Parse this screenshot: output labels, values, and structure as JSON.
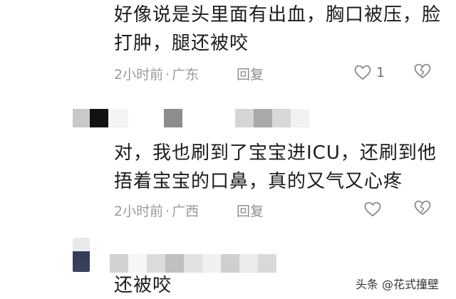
{
  "comments": [
    {
      "text_line1": "好像说是头里面有出血，胸口被压，脸",
      "text_line2": "打肿，腿还被咬",
      "time": "2小时前",
      "dot": "·",
      "location": "广东",
      "reply_label": "回复",
      "like_count": "1"
    },
    {
      "text_line1": "对，我也刷到了宝宝进ICU，还刷到他",
      "text_line2": "捂着宝宝的口鼻，真的又气又心疼",
      "time": "2小时前",
      "dot": "·",
      "location": "广西",
      "reply_label": "回复",
      "like_count": ""
    },
    {
      "text_line1": "还被咬"
    }
  ],
  "watermark": "头条 @花式撞壁",
  "icons": {
    "like": "heart-outline-icon",
    "dislike": "broken-heart-icon"
  },
  "colors": {
    "meta_text": "#9a9a9a",
    "body_text": "#1b1b1b",
    "icon_stroke": "#8a8a8a"
  }
}
